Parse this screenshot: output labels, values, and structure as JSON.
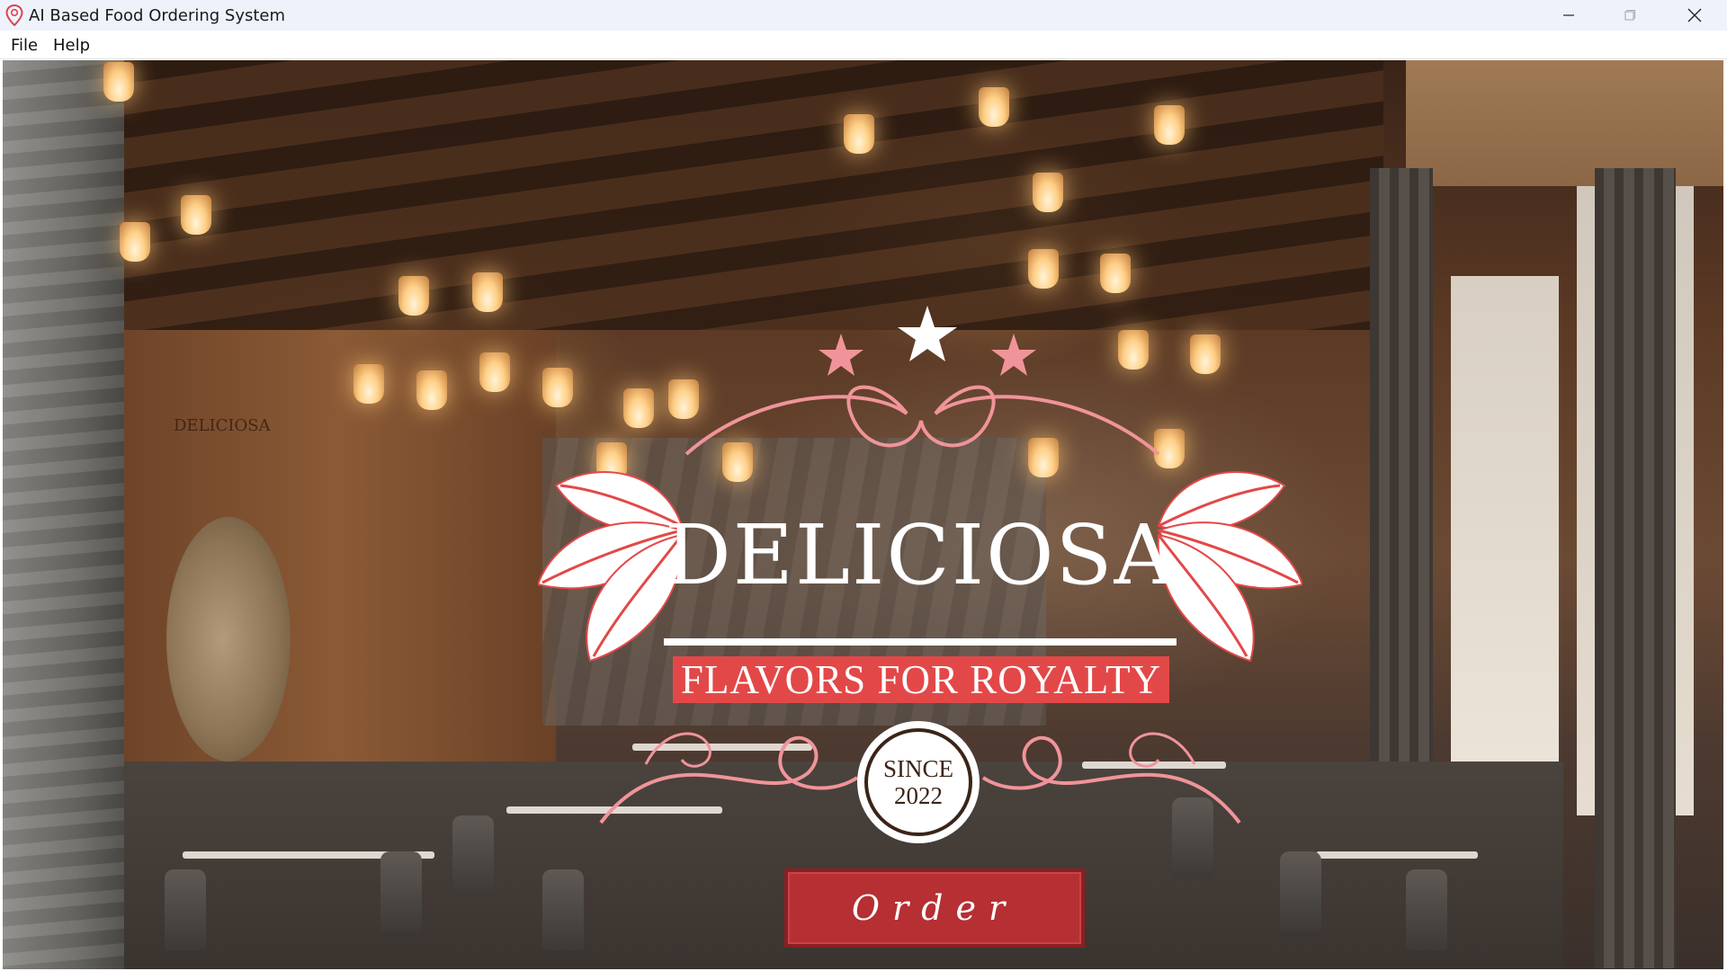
{
  "window": {
    "title": "AI Based Food Ordering System",
    "icon": "map-pin-icon",
    "controls": [
      "minimize-icon",
      "maximize-icon",
      "close-icon"
    ]
  },
  "menu": {
    "file": "File",
    "help": "Help"
  },
  "logo": {
    "brand": "DELICIOSA",
    "tagline": "FLAVORS FOR ROYALTY",
    "since_line1": "SINCE",
    "since_line2": "2022",
    "wall_sign": "DELICIOSA"
  },
  "order_button": {
    "label": "Order"
  },
  "colors": {
    "accent_red": "#e34848",
    "button_red": "#b52f33",
    "ornament_pink": "#f0949a",
    "badge_brown": "#3b2417"
  }
}
